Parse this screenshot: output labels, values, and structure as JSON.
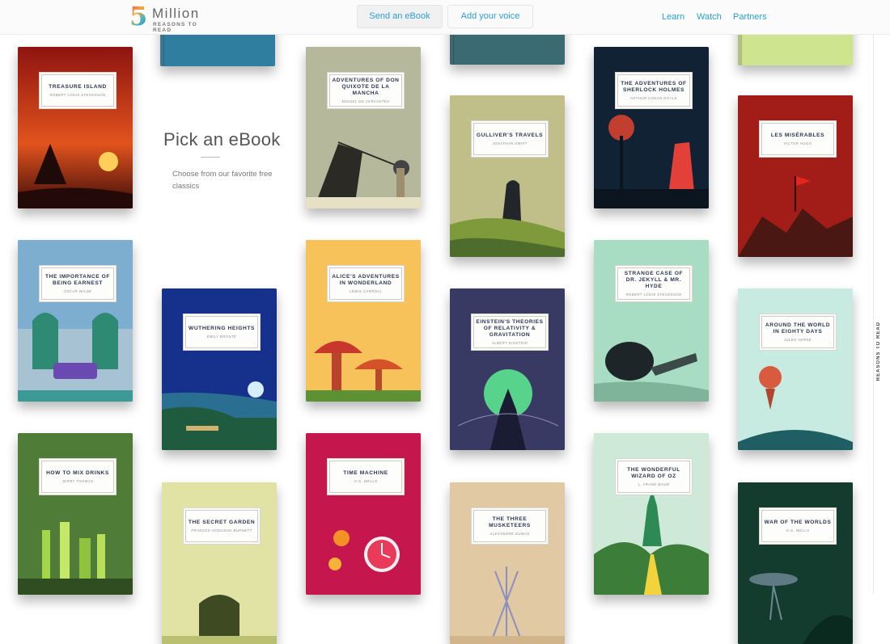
{
  "header": {
    "logo_number": "5",
    "logo_word": "Million",
    "logo_tagline": "REASONS TO READ",
    "send_label": "Send an eBook",
    "voice_label": "Add your voice",
    "nav": [
      "Learn",
      "Watch",
      "Partners"
    ]
  },
  "intro": {
    "title": "Pick an eBook",
    "description": "Choose from our favorite free classics"
  },
  "side_tag": "REASONS TO READ",
  "books": [
    {
      "title": "Treasure Island",
      "author": "Robert Louis Stevenson",
      "color": "#a51d1a"
    },
    {
      "title": "Adventures of Don Quixote de la Mancha",
      "author": "Miguel de Cervantes",
      "color": "#a9aa8c"
    },
    {
      "title": "Gulliver's Travels",
      "author": "Jonathan Swift",
      "color": "#b7b684"
    },
    {
      "title": "The Adventures of Sherlock Holmes",
      "author": "Arthur Conan Doyle",
      "color": "#16283a"
    },
    {
      "title": "Les Misérables",
      "author": "Victor Hugo",
      "color": "#9c1c18"
    },
    {
      "title": "The Importance of Being Earnest",
      "author": "Oscar Wilde",
      "color": "#6da0c2"
    },
    {
      "title": "Wuthering Heights",
      "author": "Emily Brontë",
      "color": "#17348a"
    },
    {
      "title": "Alice's Adventures in Wonderland",
      "author": "Lewis Carroll",
      "color": "#f6bb4d"
    },
    {
      "title": "Einstein's Theories of Relativity & Gravitation",
      "author": "Albert Einstein",
      "color": "#383a63"
    },
    {
      "title": "Strange Case of Dr. Jekyll & Mr. Hyde",
      "author": "Robert Louis Stevenson",
      "color": "#a7dbc0"
    },
    {
      "title": "Around the World in Eighty Days",
      "author": "Jules Verne",
      "color": "#c2e9dd"
    },
    {
      "title": "How to Mix Drinks",
      "author": "Jerry Thomas",
      "color": "#4f7c37"
    },
    {
      "title": "The Secret Garden",
      "author": "Frances Hodgson Burnett",
      "color": "#dfe2a1"
    },
    {
      "title": "Time Machine",
      "author": "H.G. Wells",
      "color": "#c3174c"
    },
    {
      "title": "The Three Musketeers",
      "author": "Alexandre Dumas",
      "color": "#e1c9a3"
    },
    {
      "title": "The Wonderful Wizard of Oz",
      "author": "L. Frank Baum",
      "color": "#c7e7d3"
    },
    {
      "title": "War of the Worlds",
      "author": "H.G. Wells",
      "color": "#123a2c"
    }
  ]
}
